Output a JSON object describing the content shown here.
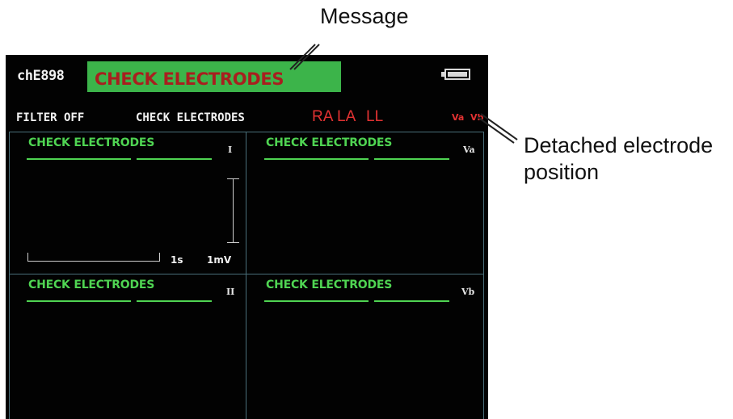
{
  "callouts": {
    "message": "Message",
    "detached_line1": "Detached electrode",
    "detached_line2": "position"
  },
  "screen": {
    "device_id": "chE898",
    "message": "CHECK ELECTRODES",
    "battery_level": 1.0,
    "filter_status": "FILTER OFF",
    "check_status": "CHECK ELECTRODES",
    "detached_electrodes": [
      "RA",
      "LA",
      "LL",
      "Va",
      "Vb"
    ]
  },
  "panels": [
    {
      "message": "CHECK ELECTRODES",
      "lead": "I"
    },
    {
      "message": "CHECK ELECTRODES",
      "lead": "Va"
    },
    {
      "message": "CHECK ELECTRODES",
      "lead": "II"
    },
    {
      "message": "CHECK ELECTRODES",
      "lead": "Vb"
    }
  ],
  "scale": {
    "time": "1s",
    "amplitude": "1mV"
  },
  "colors": {
    "screen_bg": "#020202",
    "message_bg": "#3cb44a",
    "message_text": "#a81f1f",
    "trace_green": "#4fd452",
    "alert_red": "#e23232",
    "grid_line": "#4a6f7a"
  }
}
